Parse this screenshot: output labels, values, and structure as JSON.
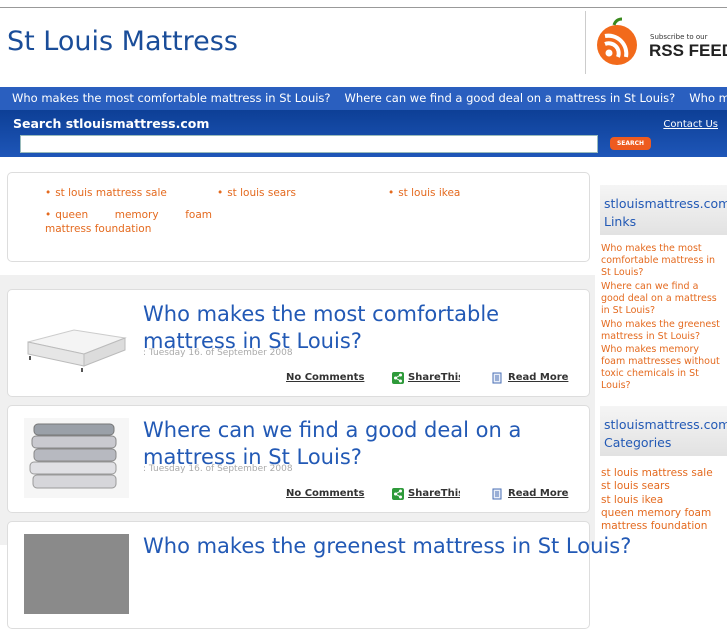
{
  "header": {
    "site_title": "St Louis Mattress",
    "rss_subscribe": "Subscribe to our",
    "rss_feed": "RSS FEED"
  },
  "nav": {
    "items": [
      "Who makes the most comfortable mattress in St Louis?",
      "Where can we find a good deal on a mattress in St Louis?",
      "Who makes the greenest mattress in St Louis?"
    ]
  },
  "search": {
    "label": "Search stlouismattress.com",
    "contact": "Contact Us",
    "button": "SEARCH",
    "placeholder": ""
  },
  "tags": [
    "st louis mattress sale",
    "st louis sears",
    "st louis ikea",
    "queen memory foam mattress foundation"
  ],
  "posts": [
    {
      "title": "Who makes the most comfortable mattress in St Louis?",
      "date": ": Tuesday 16. of September 2008",
      "comments": "No Comments",
      "share": "ShareThis",
      "read_more": "Read More"
    },
    {
      "title": "Where can we find a good deal on a mattress in St Louis?",
      "date": ": Tuesday 16. of September 2008",
      "comments": "No Comments",
      "share": "ShareThis",
      "read_more": "Read More"
    },
    {
      "title": "Who makes the greenest mattress in St Louis?"
    }
  ],
  "sidebar": {
    "links_heading": "stlouismattress.com Links",
    "links": [
      "Who makes the most comfortable mattress in St Louis?",
      "Where can we find a good deal on a mattress in St Louis?",
      "Who makes the greenest mattress in St Louis?",
      "Who makes memory foam mattresses without toxic chemicals in St Louis?"
    ],
    "categories_heading": "stlouismattress.com Categories",
    "categories": [
      "st louis mattress sale",
      "st louis sears",
      "st louis ikea",
      "queen memory foam",
      "mattress foundation"
    ]
  },
  "colors": {
    "accent_blue": "#2a5fbf",
    "title_blue": "#1a4d99",
    "link_orange": "#e46a1f",
    "search_orange": "#ee5b1f"
  }
}
